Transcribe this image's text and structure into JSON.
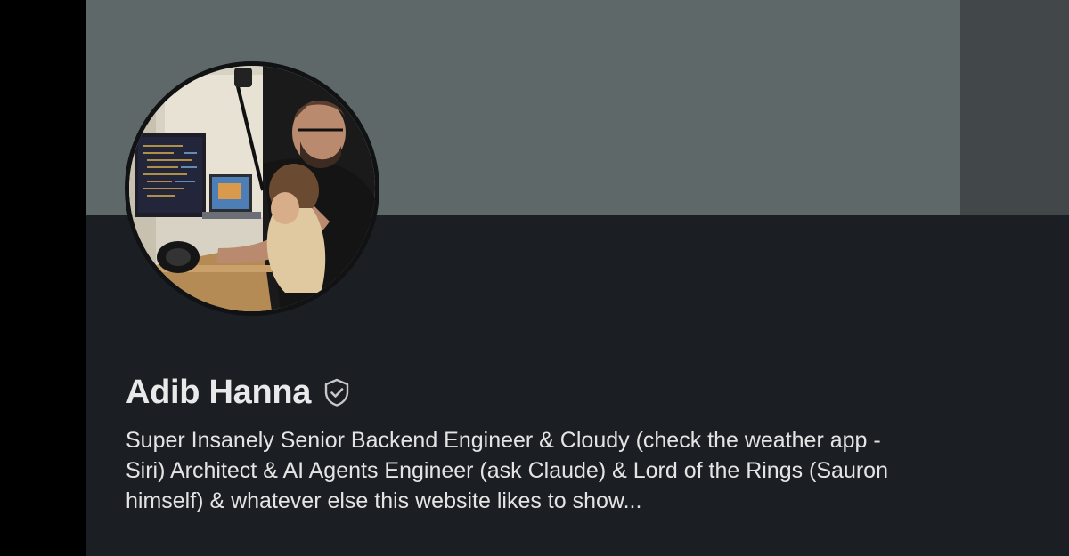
{
  "profile": {
    "name": "Adib Hanna",
    "verified_icon": "verified-shield-check-icon",
    "headline": "Super Insanely Senior Backend Engineer & Cloudy (check the weather app - Siri) Architect & AI Agents Engineer (ask Claude) & Lord of the Rings (Sauron himself) & whatever else this website likes to show...",
    "avatar_description": "profile-photo"
  },
  "colors": {
    "card_background": "#1b1f23",
    "banner_light": "#5f6869",
    "banner_dark": "#42484a",
    "text_primary": "#e9e9e9",
    "verified_icon_color": "#c8c8c8"
  }
}
